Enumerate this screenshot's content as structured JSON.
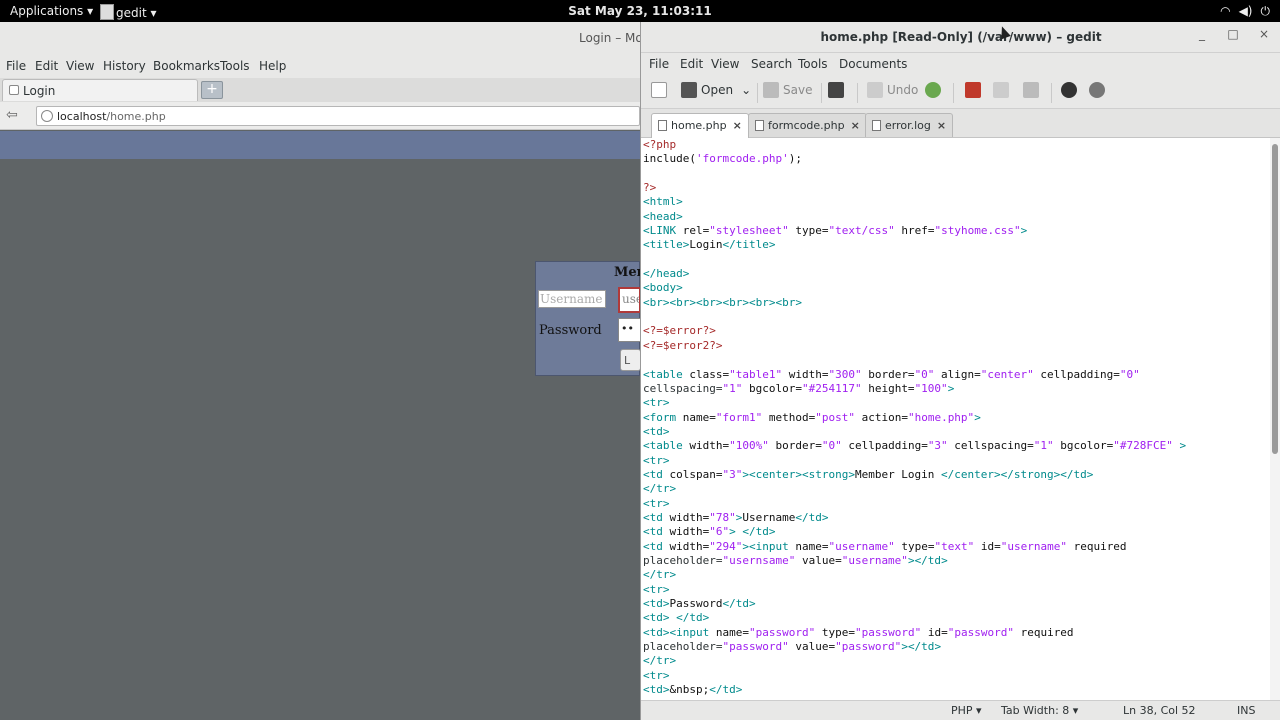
{
  "topbar": {
    "applications": "Applications ▾",
    "app_name": "gedit ▾",
    "clock": "Sat May 23, 11:03:11",
    "tray_icons": [
      "wifi-icon",
      "volume-icon",
      "power-icon"
    ]
  },
  "firefox": {
    "window_title": "Login – Mo",
    "menu": [
      "File",
      "Edit",
      "View",
      "History",
      "Bookmarks",
      "Tools",
      "Help"
    ],
    "tab_label": "Login",
    "new_tab": "+",
    "url_host": "localhost",
    "url_path": "/home.php",
    "login_form": {
      "heading": "Mem",
      "username_label": "Username",
      "username_value": "use",
      "password_label": "Password",
      "password_value": "••",
      "button_label": "L"
    }
  },
  "gedit": {
    "window_title": "home.php [Read-Only] (/var/www) – gedit",
    "window_buttons": [
      "_",
      "□",
      "×"
    ],
    "menu": [
      "File",
      "Edit",
      "View",
      "Search",
      "Tools",
      "Documents"
    ],
    "toolbar": {
      "open": "Open",
      "save": "Save",
      "undo": "Undo"
    },
    "tabs": [
      {
        "label": "home.php",
        "close": "×"
      },
      {
        "label": "formcode.php",
        "close": "×"
      },
      {
        "label": "error.log",
        "close": "×"
      }
    ],
    "status": {
      "language": "PHP ▾",
      "tab_width": "Tab Width: 8 ▾",
      "position": "Ln 38, Col 52",
      "mode": "INS"
    }
  },
  "code_lines": [
    "<?php",
    "include('formcode.php');",
    "",
    "?>",
    "<html>",
    "<head>",
    "<LINK rel=\"stylesheet\" type=\"text/css\" href=\"styhome.css\">",
    "<title>Login</title>",
    "",
    "</head>",
    "<body>",
    "<br><br><br><br><br><br>",
    "",
    "<?=$error?>",
    "<?=$error2?>",
    "",
    "<table class=\"table1\" width=\"300\" border=\"0\" align=\"center\" cellpadding=\"0\"",
    "cellspacing=\"1\" bgcolor=\"#254117\" height=\"100\">",
    "<tr>",
    "<form name=\"form1\" method=\"post\" action=\"home.php\">",
    "<td>",
    "<table width=\"100%\" border=\"0\" cellpadding=\"3\" cellspacing=\"1\" bgcolor=\"#728FCE\" >",
    "<tr>",
    "<td colspan=\"3\"><center><strong>Member Login </center></strong></td>",
    "</tr>",
    "<tr>",
    "<td width=\"78\">Username</td>",
    "<td width=\"6\"> </td>",
    "<td width=\"294\"><input name=\"username\" type=\"text\" id=\"username\" required",
    "placeholder=\"usernsame\" value=\"username\"></td>",
    "</tr>",
    "<tr>",
    "<td>Password</td>",
    "<td> </td>",
    "<td><input name=\"password\" type=\"password\" id=\"password\" required",
    "placeholder=\"password\" value=\"password\"></td>",
    "</tr>",
    "<tr>",
    "<td>&nbsp;</td>"
  ]
}
